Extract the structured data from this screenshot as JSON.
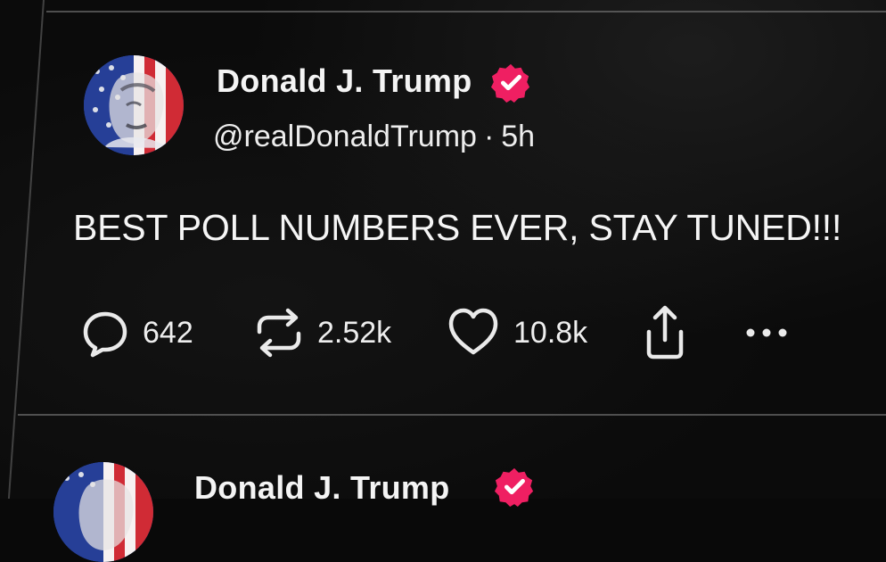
{
  "post": {
    "display_name": "Donald J. Trump",
    "handle": "@realDonaldTrump",
    "separator": "·",
    "time": "5h",
    "body": "BEST POLL NUMBERS EVER, STAY TUNED!!!",
    "stats": {
      "replies": "642",
      "reposts": "2.52k",
      "likes": "10.8k"
    }
  },
  "next_post": {
    "display_name": "Donald J. Trump"
  },
  "icons": {
    "reply": "reply-icon",
    "repost": "repost-icon",
    "like": "heart-icon",
    "share": "share-icon",
    "more": "more-icon",
    "verified": "verified-badge-icon"
  },
  "colors": {
    "background": "#0b0b0b",
    "text": "#f2f2f2",
    "verified_badge": "#ef1f62",
    "divider": "#878787"
  }
}
